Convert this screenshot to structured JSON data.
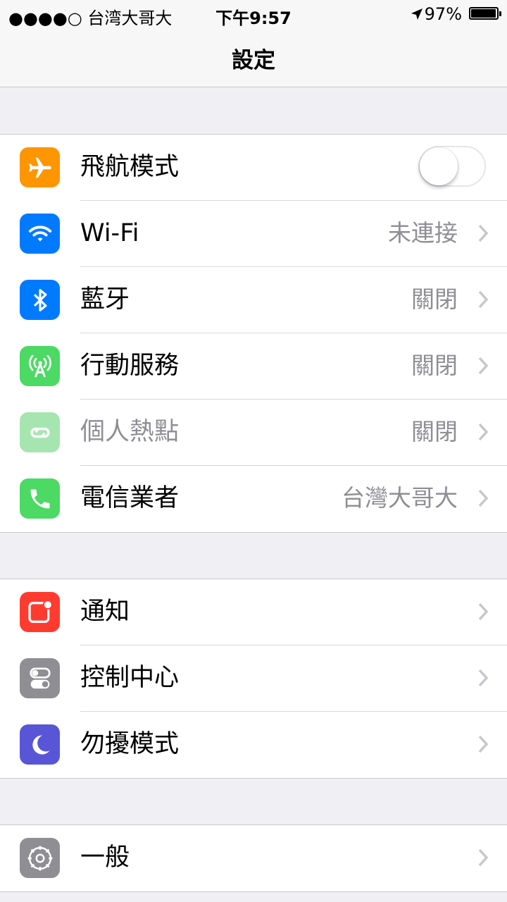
{
  "status_bar": {
    "carrier": "●●●●○ 台湾大哥大",
    "time": "下午9:57",
    "battery": "97%"
  },
  "nav": {
    "title": "設定"
  },
  "groups": [
    [
      {
        "label": "飛航模式",
        "icon": "airplane-icon",
        "color": "#ff9500",
        "toggle": "off"
      },
      {
        "label": "Wi-Fi",
        "value": "未連接",
        "icon": "wifi-icon",
        "color": "#007aff"
      },
      {
        "label": "藍牙",
        "value": "關閉",
        "icon": "bluetooth-icon",
        "color": "#007aff"
      },
      {
        "label": "行動服務",
        "value": "關閉",
        "icon": "cellular-antenna-icon",
        "color": "#4cd964"
      },
      {
        "label": "個人熱點",
        "value": "關閉",
        "icon": "hotspot-link-icon",
        "color": "#a6e5b0"
      },
      {
        "label": "電信業者",
        "value": "台灣大哥大",
        "icon": "phone-icon",
        "color": "#4cd964"
      }
    ],
    [
      {
        "label": "通知",
        "icon": "notifications-icon",
        "color": "#ff3b30"
      },
      {
        "label": "控制中心",
        "icon": "control-center-icon",
        "color": "#8e8e93"
      },
      {
        "label": "勿擾模式",
        "icon": "moon-icon",
        "color": "#5856d6"
      }
    ],
    [
      {
        "label": "一般",
        "icon": "gear-icon",
        "color": "#8e8e93"
      }
    ]
  ]
}
